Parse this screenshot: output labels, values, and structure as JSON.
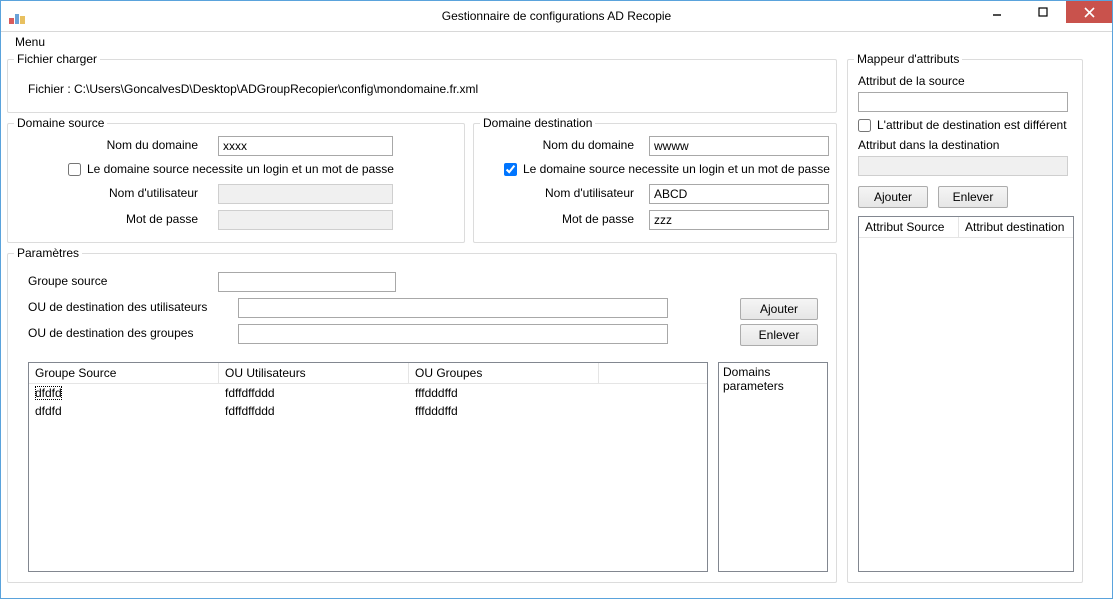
{
  "window": {
    "title": "Gestionnaire de configurations AD Recopie"
  },
  "menu": {
    "item": "Menu"
  },
  "fichier": {
    "group_label": "Fichier charger",
    "line_prefix": "Fichier : ",
    "path": "C:\\Users\\GoncalvesD\\Desktop\\ADGroupRecopier\\config\\mondomaine.fr.xml"
  },
  "dom_src": {
    "group_label": "Domaine source",
    "lbl_domain": "Nom du domaine",
    "val_domain": "xxxx",
    "chk_login": "Le domaine source necessite un login et un mot de passe",
    "chk_login_checked": false,
    "lbl_user": "Nom d'utilisateur",
    "val_user": "",
    "lbl_pass": "Mot de passe",
    "val_pass": ""
  },
  "dom_dst": {
    "group_label": "Domaine destination",
    "lbl_domain": "Nom du domaine",
    "val_domain": "wwww",
    "chk_login": "Le domaine source necessite un login et un mot de passe",
    "chk_login_checked": true,
    "lbl_user": "Nom d'utilisateur",
    "val_user": "ABCD",
    "lbl_pass": "Mot de passe",
    "val_pass": "zzz"
  },
  "params": {
    "group_label": "Paramètres",
    "lbl_group_src": "Groupe source",
    "val_group_src": "",
    "lbl_ou_users": "OU de destination des utilisateurs",
    "val_ou_users": "",
    "lbl_ou_groups": "OU de destination des groupes",
    "val_ou_groups": "",
    "btn_add": "Ajouter",
    "btn_remove": "Enlever",
    "cols": {
      "c0": "Groupe Source",
      "c1": "OU Utilisateurs",
      "c2": "OU Groupes"
    },
    "rows": [
      {
        "c0": "dfdfd",
        "c1": "fdffdffddd",
        "c2": "fffdddffd"
      },
      {
        "c0": "dfdfd",
        "c1": "fdffdffddd",
        "c2": "fffdddffd"
      }
    ],
    "tree": {
      "n0": "Domains",
      "n1": "parameters"
    }
  },
  "mapper": {
    "group_label": "Mappeur d'attributs",
    "lbl_src_attr": "Attribut de la source",
    "val_src_attr": "",
    "chk_diff": "L'attribut de destination est différent",
    "chk_diff_checked": false,
    "lbl_dst_attr": "Attribut dans la destination",
    "val_dst_attr": "",
    "btn_add": "Ajouter",
    "btn_remove": "Enlever",
    "cols": {
      "c0": "Attribut Source",
      "c1": "Attribut destination"
    }
  }
}
